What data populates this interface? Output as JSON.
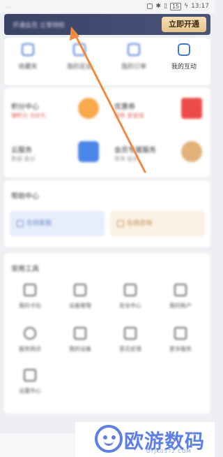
{
  "status": {
    "left_text": "...",
    "time": "13:17",
    "battery": "15"
  },
  "vip": {
    "promo_text": "开通会员 立享特权",
    "button_label": "立即开通"
  },
  "quick_actions": [
    {
      "label": "收藏夹",
      "icon": "folder-icon"
    },
    {
      "label": "我的足迹",
      "icon": "footprint-icon"
    },
    {
      "label": "我的订单",
      "icon": "order-list-icon"
    },
    {
      "label": "我的互动",
      "icon": "chat-bubble-icon"
    }
  ],
  "services": [
    {
      "title": "积分中心",
      "subtitle": "赚积分 兑好礼",
      "color": "#f7a94b"
    },
    {
      "title": "优惠券",
      "subtitle": "领券 更省钱",
      "color": "#ef4a4a"
    },
    {
      "title": "云服务",
      "subtitle": "数据 备份",
      "color": "#4a86e8"
    },
    {
      "title": "会员专属服务",
      "subtitle": "尊享 服务",
      "color": "#e3b27a"
    }
  ],
  "help_section": {
    "title": "帮助中心",
    "left_pill": "在线客服",
    "right_pill": "在线咨询"
  },
  "tools": {
    "title": "常用工具",
    "items": [
      {
        "label": "我的卡包",
        "icon": "wallet-icon"
      },
      {
        "label": "设备管理",
        "icon": "device-icon"
      },
      {
        "label": "安全中心",
        "icon": "shield-icon"
      },
      {
        "label": "我的账户",
        "icon": "account-icon"
      },
      {
        "label": "服务网点",
        "icon": "location-icon"
      },
      {
        "label": "我的设备",
        "icon": "phone-icon"
      },
      {
        "label": "意见反馈",
        "icon": "feedback-icon"
      },
      {
        "label": "更多服务",
        "icon": "more-icon"
      }
    ],
    "extra": {
      "label": "设置中心",
      "icon": "settings-icon"
    }
  },
  "watermark": {
    "brand": "欧游数码",
    "url": "OYJK0572.COM"
  },
  "colors": {
    "accent": "#f08a3c",
    "vip_bar": "#3a4266",
    "vip_button": "#e7c38a",
    "link_blue": "#3f78d6"
  }
}
